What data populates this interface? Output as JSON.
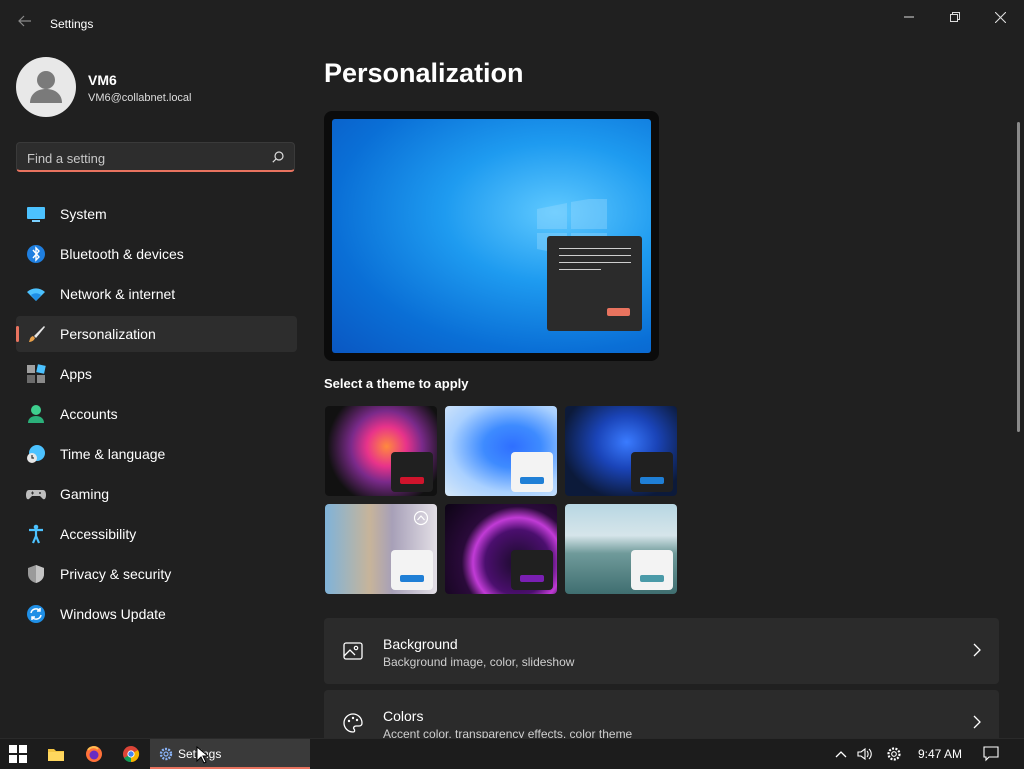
{
  "window": {
    "title": "Settings"
  },
  "profile": {
    "name": "VM6",
    "email": "VM6@collabnet.local"
  },
  "search": {
    "placeholder": "Find a setting"
  },
  "sidebar": {
    "items": [
      {
        "label": "System",
        "icon": "system-icon"
      },
      {
        "label": "Bluetooth & devices",
        "icon": "bluetooth-icon"
      },
      {
        "label": "Network & internet",
        "icon": "wifi-icon"
      },
      {
        "label": "Personalization",
        "icon": "brush-icon",
        "active": true
      },
      {
        "label": "Apps",
        "icon": "apps-icon"
      },
      {
        "label": "Accounts",
        "icon": "account-icon"
      },
      {
        "label": "Time & language",
        "icon": "clock-globe-icon"
      },
      {
        "label": "Gaming",
        "icon": "gamepad-icon"
      },
      {
        "label": "Accessibility",
        "icon": "accessibility-icon"
      },
      {
        "label": "Privacy & security",
        "icon": "shield-icon"
      },
      {
        "label": "Windows Update",
        "icon": "update-icon"
      }
    ]
  },
  "main": {
    "title": "Personalization",
    "themes_heading": "Select a theme to apply",
    "cards": [
      {
        "title": "Background",
        "subtitle": "Background image, color, slideshow",
        "icon": "image-icon"
      },
      {
        "title": "Colors",
        "subtitle": "Accent color, transparency effects, color theme",
        "icon": "palette-icon"
      }
    ]
  },
  "taskbar": {
    "settings_label": "Settings",
    "time": "9:47 AM"
  },
  "colors": {
    "accent": "#e8735f",
    "background": "#202020",
    "card": "#2b2b2b"
  }
}
